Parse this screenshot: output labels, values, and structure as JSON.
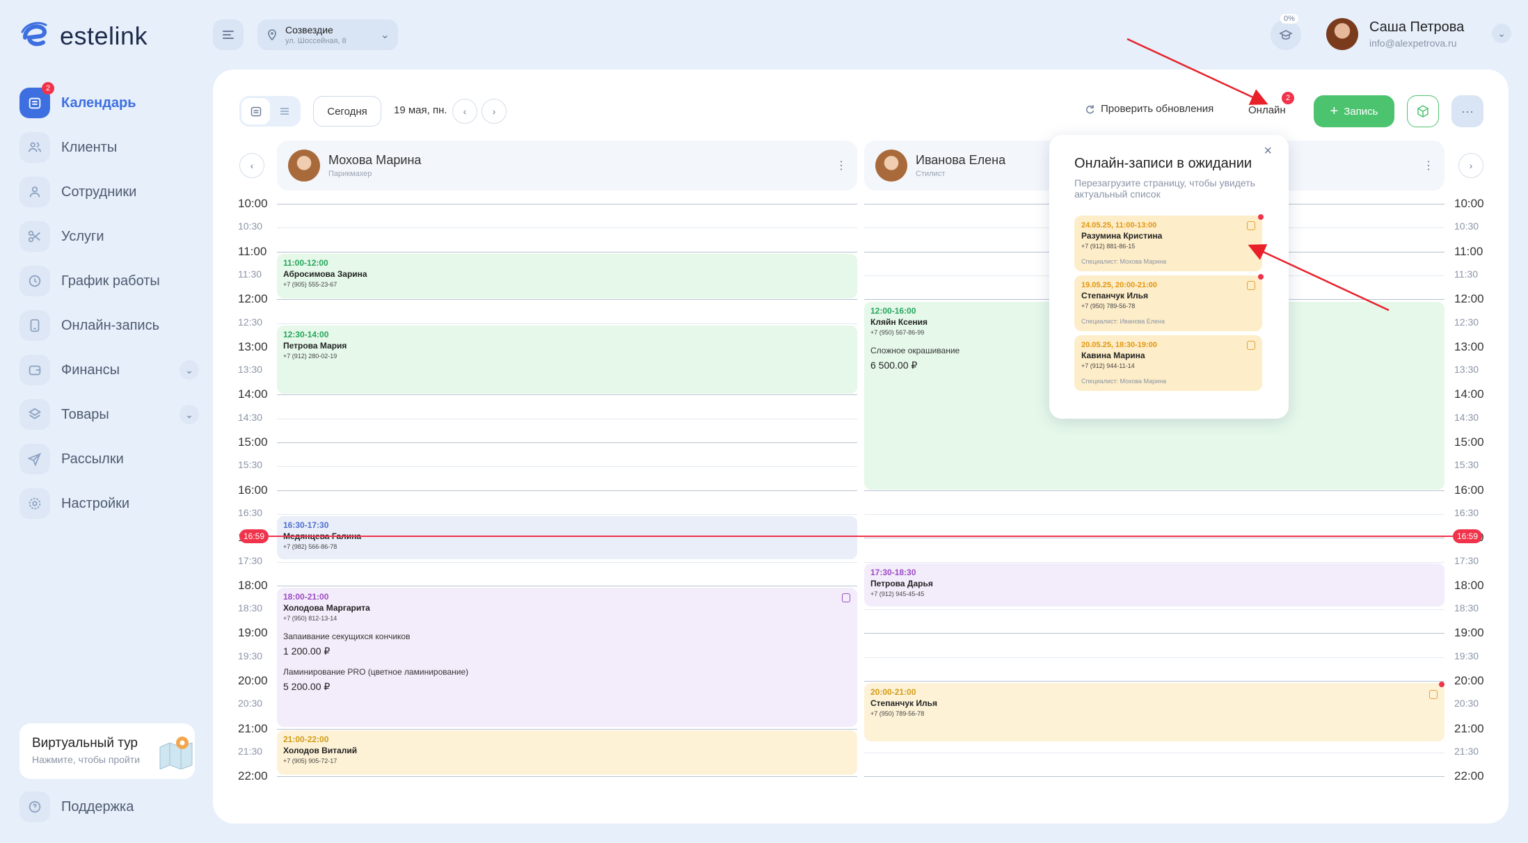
{
  "logo": {
    "text": "estelink"
  },
  "nav": {
    "items": [
      {
        "label": "Календарь",
        "badge": "2"
      },
      {
        "label": "Клиенты"
      },
      {
        "label": "Сотрудники"
      },
      {
        "label": "Услуги"
      },
      {
        "label": "График работы"
      },
      {
        "label": "Онлайн-запись"
      },
      {
        "label": "Финансы"
      },
      {
        "label": "Товары"
      },
      {
        "label": "Рассылки"
      },
      {
        "label": "Настройки"
      }
    ]
  },
  "tour": {
    "title": "Виртуальный тур",
    "subtitle": "Нажмите, чтобы пройти"
  },
  "support": {
    "label": "Поддержка"
  },
  "location": {
    "name": "Созвездие",
    "address": "ул. Шоссейная, 8"
  },
  "progress": {
    "label": "0%"
  },
  "user": {
    "name": "Саша Петрова",
    "email": "info@alexpetrova.ru"
  },
  "toolbar": {
    "today": "Сегодня",
    "date": "19 мая, пн.",
    "check_updates": "Проверить обновления",
    "online": "Онлайн",
    "online_badge": "2",
    "new_record": "Запись"
  },
  "staff": [
    {
      "name": "Мохова Марина",
      "role": "Парикмахер"
    },
    {
      "name": "Иванова Елена",
      "role": "Стилист"
    }
  ],
  "times": [
    "10:00",
    "10:30",
    "11:00",
    "11:30",
    "12:00",
    "12:30",
    "13:00",
    "13:30",
    "14:00",
    "14:30",
    "15:00",
    "15:30",
    "16:00",
    "16:30",
    "17:00",
    "17:30",
    "18:00",
    "18:30",
    "19:00",
    "19:30",
    "20:00",
    "20:30",
    "21:00",
    "21:30",
    "22:00"
  ],
  "now": "16:59",
  "events": {
    "col1": [
      {
        "time": "11:00-12:00",
        "name": "Абросимова Зарина",
        "phone": "+7 (905) 555-23-67"
      },
      {
        "time": "12:30-14:00",
        "name": "Петрова Мария",
        "phone": "+7 (912) 280-02-19"
      },
      {
        "time": "16:30-17:30",
        "name": "Медянцева Галина",
        "phone": "+7 (982) 566-86-78"
      },
      {
        "time": "18:00-21:00",
        "name": "Холодова Маргарита",
        "phone": "+7 (950) 812-13-14",
        "service1": "Запаивание секущихся кончиков",
        "price1": "1 200.00 ₽",
        "service2": "Ламинирование PRO (цветное ламинирование)",
        "price2": "5 200.00 ₽"
      },
      {
        "time": "21:00-22:00",
        "name": "Холодов Виталий",
        "phone": "+7 (905) 905-72-17"
      }
    ],
    "col2": [
      {
        "time": "12:00-16:00",
        "name": "Кляйн Ксения",
        "phone": "+7 (950) 567-86-99",
        "service1": "Сложное окрашивание",
        "price1": "6 500.00 ₽"
      },
      {
        "time": "17:30-18:30",
        "name": "Петрова Дарья",
        "phone": "+7 (912) 945-45-45"
      },
      {
        "time": "20:00-21:00",
        "name": "Степанчук Илья",
        "phone": "+7 (950) 789-56-78"
      }
    ]
  },
  "popup": {
    "title": "Онлайн-записи в ожидании",
    "subtitle": "Перезагрузите страницу, чтобы увидеть актуальный список",
    "cards": [
      {
        "time": "24.05.25, 11:00-13:00",
        "name": "Разумина Кристина",
        "phone": "+7 (912) 881-86-15",
        "specialist": "Специалист: Мохова Марина"
      },
      {
        "time": "19.05.25, 20:00-21:00",
        "name": "Степанчук Илья",
        "phone": "+7 (950) 789-56-78",
        "specialist": "Специалист: Иванова Елена"
      },
      {
        "time": "20.05.25, 18:30-19:00",
        "name": "Кавина Марина",
        "phone": "+7 (912) 944-11-14",
        "specialist": "Специалист: Мохова Марина"
      }
    ]
  },
  "colors": {
    "accent": "#3d6fe0",
    "green": "#4cc36f",
    "red": "#f0334a"
  }
}
